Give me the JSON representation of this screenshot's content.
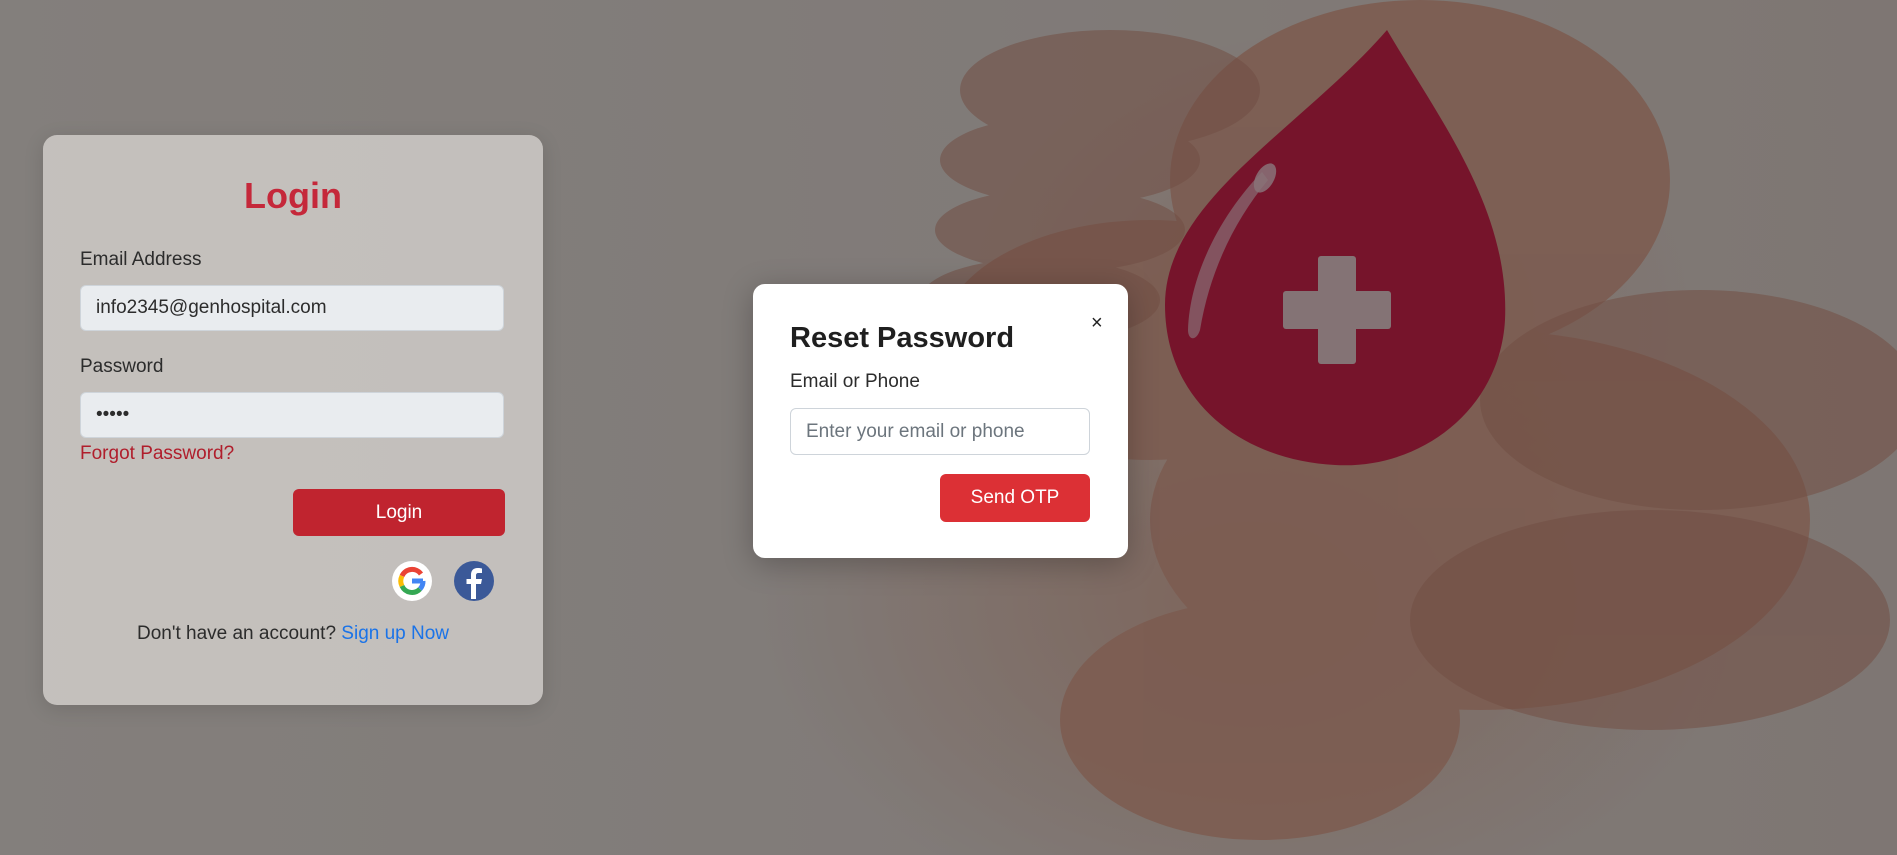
{
  "login": {
    "title": "Login",
    "email_label": "Email Address",
    "email_value": "info2345@genhospital.com",
    "password_label": "Password",
    "password_value": "•••••",
    "forgot_link": "Forgot Password?",
    "login_button": "Login",
    "signup_prompt": "Don't have an account? ",
    "signup_link": "Sign up Now"
  },
  "modal": {
    "title": "Reset Password",
    "close_label": "×",
    "field_label": "Email or Phone",
    "field_placeholder": "Enter your email or phone",
    "send_button": "Send OTP"
  },
  "colors": {
    "brand_red": "#c0242f",
    "accent_red": "#dc3035",
    "link_blue": "#1a73e8",
    "facebook_blue": "#3b5998"
  },
  "icons": [
    "google-icon",
    "facebook-icon",
    "close-icon",
    "blood-drop-cross-icon"
  ]
}
